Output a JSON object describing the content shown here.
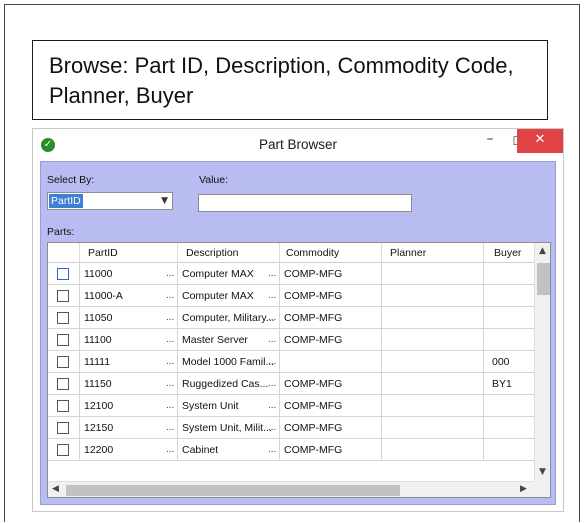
{
  "caption": "Browse: Part ID, Description, Commodity Code, Planner, Buyer",
  "window": {
    "title": "Part Browser",
    "minimize_glyph": "–",
    "maximize_glyph": "☐",
    "close_glyph": "✕"
  },
  "form": {
    "select_by_label": "Select By:",
    "select_by_value": "PartID",
    "value_label": "Value:",
    "value_text": "",
    "parts_label": "Parts:"
  },
  "grid": {
    "columns": [
      "PartID",
      "Description",
      "Commodity",
      "Planner",
      "Buyer"
    ],
    "rows": [
      {
        "part_id": "11000",
        "description": "Computer MAX",
        "commodity": "COMP-MFG",
        "planner": "",
        "buyer": "",
        "selected": true
      },
      {
        "part_id": "11000-A",
        "description": "Computer MAX",
        "commodity": "COMP-MFG",
        "planner": "",
        "buyer": "",
        "selected": false
      },
      {
        "part_id": "11050",
        "description": "Computer, Military...",
        "commodity": "COMP-MFG",
        "planner": "",
        "buyer": "",
        "selected": false
      },
      {
        "part_id": "11100",
        "description": "Master Server",
        "commodity": "COMP-MFG",
        "planner": "",
        "buyer": "",
        "selected": false
      },
      {
        "part_id": "11111",
        "description": "Model 1000 Famil...",
        "commodity": "",
        "planner": "",
        "buyer": "000",
        "selected": false
      },
      {
        "part_id": "11150",
        "description": "Ruggedized Cas...",
        "commodity": "COMP-MFG",
        "planner": "",
        "buyer": "BY1",
        "selected": false
      },
      {
        "part_id": "12100",
        "description": "System Unit",
        "commodity": "COMP-MFG",
        "planner": "",
        "buyer": "",
        "selected": false
      },
      {
        "part_id": "12150",
        "description": "System Unit, Milit...",
        "commodity": "COMP-MFG",
        "planner": "",
        "buyer": "",
        "selected": false
      },
      {
        "part_id": "12200",
        "description": "Cabinet",
        "commodity": "COMP-MFG",
        "planner": "",
        "buyer": "",
        "selected": false
      }
    ]
  },
  "icons": {
    "app": "check-circle-icon",
    "dropdown": "chevron-down-icon",
    "scroll_up": "chevron-up-icon",
    "scroll_down": "chevron-down-icon",
    "scroll_left": "chevron-left-icon",
    "scroll_right": "chevron-right-icon"
  },
  "colors": {
    "client_bg": "#b8bcf0",
    "selection": "#3f7fd4",
    "close_button": "#e04343",
    "app_icon": "#2a8c2a"
  }
}
